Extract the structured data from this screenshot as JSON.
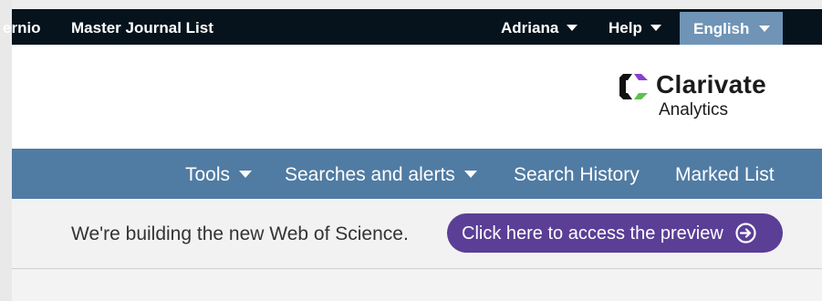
{
  "topbar": {
    "clipped_item": "ernio",
    "master_journal_list": "Master Journal List",
    "user": "Adriana",
    "help": "Help",
    "language": "English"
  },
  "logo": {
    "brand": "Clarivate",
    "sub": "Analytics"
  },
  "nav": {
    "tools": "Tools",
    "searches": "Searches and alerts",
    "history": "Search History",
    "marked": "Marked List"
  },
  "banner": {
    "message": "We're building the new Web of Science.",
    "button": "Click here to access the preview"
  },
  "colors": {
    "topbar": "#06131c",
    "nav": "#507ba3",
    "language_bg": "#6f94b6",
    "preview_button": "#5b3e96"
  }
}
